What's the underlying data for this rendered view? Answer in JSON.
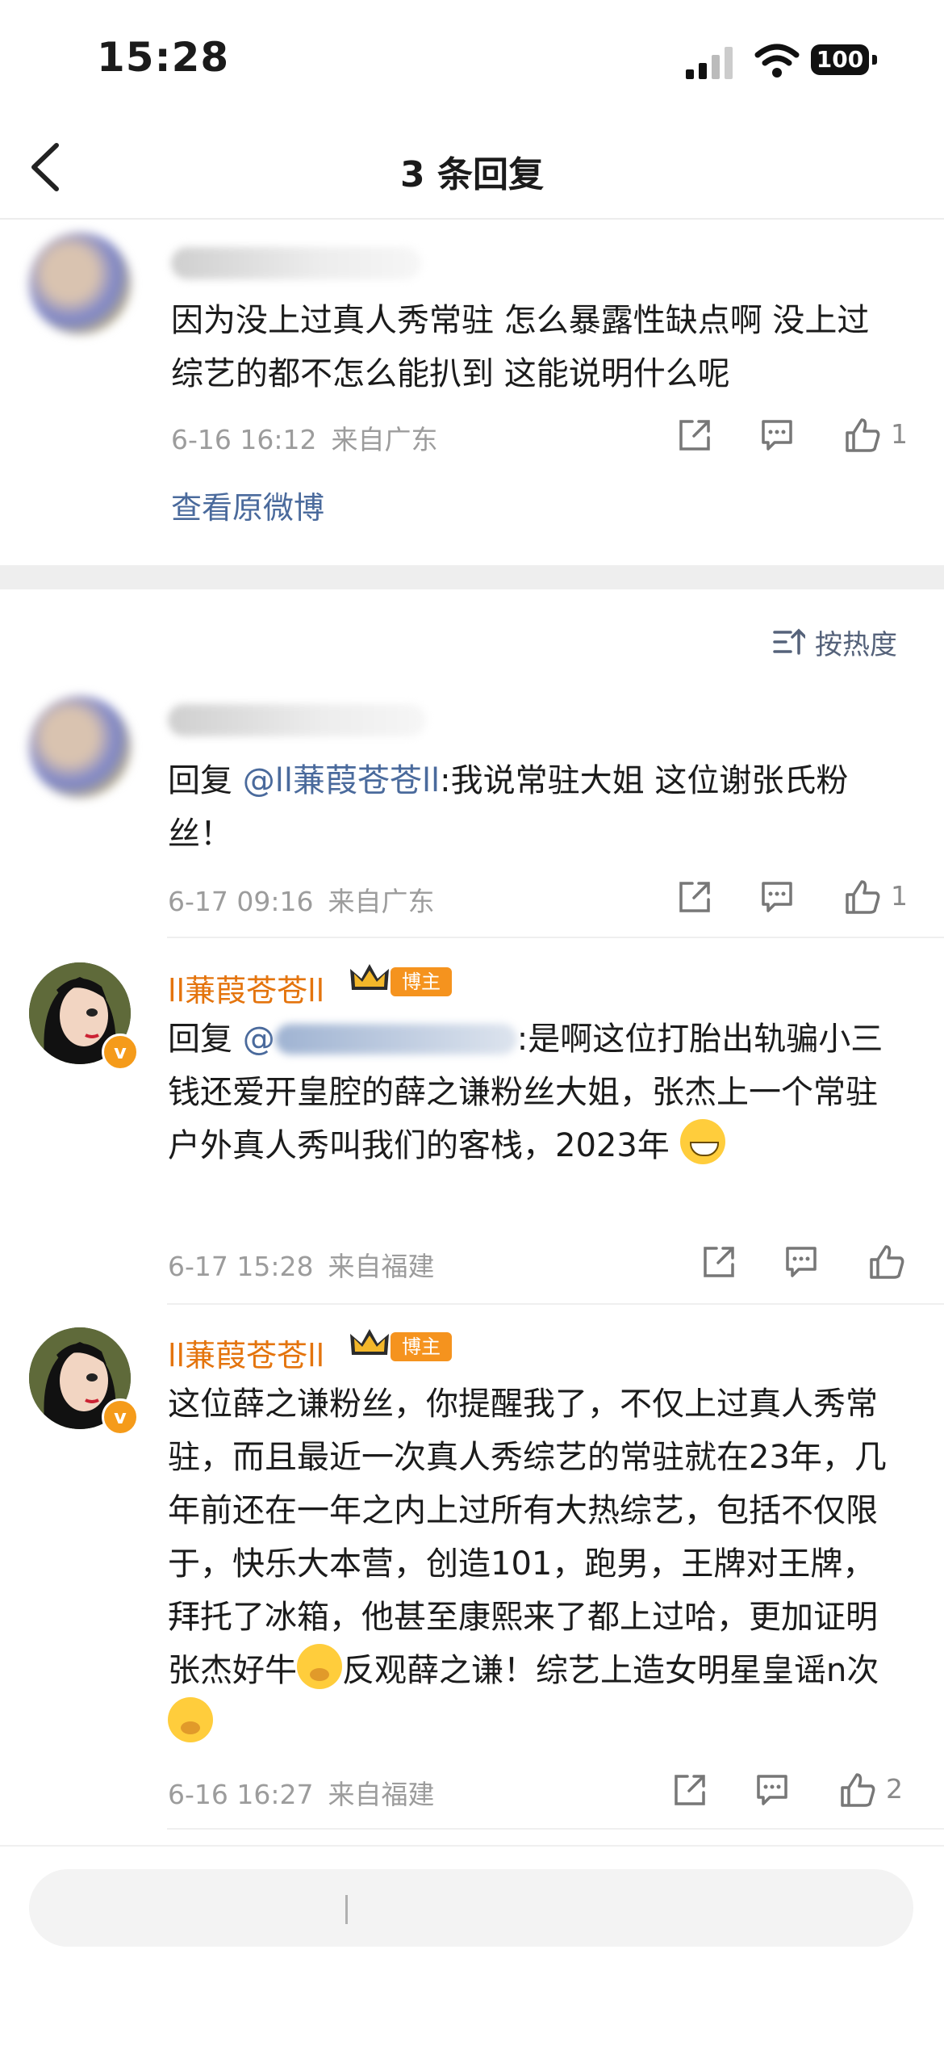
{
  "status_bar": {
    "time": "15:28",
    "battery": "100"
  },
  "nav": {
    "title": "3 条回复"
  },
  "root_comment": {
    "text": "因为没上过真人秀常驻 怎么暴露性缺点啊 没上过综艺的都不怎么能扒到 这能说明什么呢",
    "date": "6-16 16:12",
    "location": "来自广东",
    "likes": "1",
    "view_original": "查看原微博"
  },
  "sort": {
    "label": "按热度"
  },
  "replies": [
    {
      "prefix": "回复 ",
      "mention": "@ll蒹葭苍苍ll",
      "text": ":我说常驻大姐 这位谢张氏粉丝！",
      "date": "6-17 09:16",
      "location": "来自广东",
      "likes": "1"
    },
    {
      "username": "ll蒹葭苍苍ll",
      "badge": "博主",
      "prefix": "回复 ",
      "mention": "@",
      "text": ":是啊这位打胎出轨骗小三钱还爱开皇腔的薛之谦粉丝大姐，张杰上一个常驻户外真人秀叫我们的客栈，2023年",
      "date": "6-17 15:28",
      "location": "来自福建",
      "likes": ""
    },
    {
      "username": "ll蒹葭苍苍ll",
      "badge": "博主",
      "text_a": "这位薛之谦粉丝，你提醒我了，不仅上过真人秀常驻，而且最近一次真人秀综艺的常驻就在23年，几年前还在一年之内上过所有大热综艺，包括不仅限于，快乐大本营，创造101，跑男，王牌对王牌，拜托了冰箱，他甚至康熙来了都上过哈，更加证明张杰好牛",
      "text_b": "反观薛之谦！综艺上造女明星皇谣n次",
      "date": "6-16 16:27",
      "location": "来自福建",
      "likes": "2"
    }
  ]
}
